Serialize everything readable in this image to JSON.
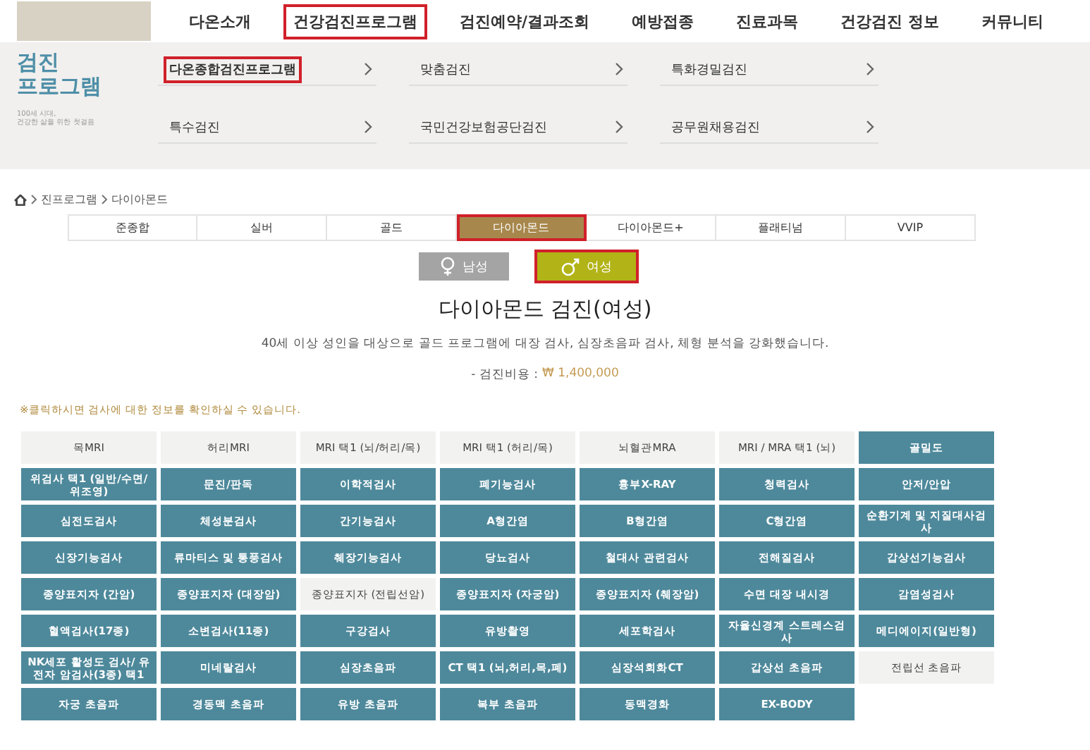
{
  "nav": [
    {
      "label": "다온소개",
      "highlighted": false
    },
    {
      "label": "건강검진프로그램",
      "highlighted": true
    },
    {
      "label": "검진예약/결과조회",
      "highlighted": false
    },
    {
      "label": "예방접종",
      "highlighted": false
    },
    {
      "label": "진료과목",
      "highlighted": false
    },
    {
      "label": "건강검진 정보",
      "highlighted": false
    },
    {
      "label": "커뮤니티",
      "highlighted": false
    }
  ],
  "submenu": {
    "title_lines": [
      "검진",
      "프로그램"
    ],
    "subtitle_lines": [
      "100세 시대,",
      "건강한 삶을 위한 첫걸음"
    ],
    "items": [
      {
        "label": "다온종합검진프로그램",
        "highlighted": true
      },
      {
        "label": "맞춤검진",
        "highlighted": false
      },
      {
        "label": "특화경밀검진",
        "highlighted": false
      },
      {
        "label": "특수검진",
        "highlighted": false
      },
      {
        "label": "국민건강보험공단검진",
        "highlighted": false
      },
      {
        "label": "공무원채용검진",
        "highlighted": false
      }
    ]
  },
  "breadcrumb": [
    "진프로그램",
    "다이아몬드"
  ],
  "tabs": [
    {
      "label": "준종합",
      "selected": false
    },
    {
      "label": "실버",
      "selected": false
    },
    {
      "label": "골드",
      "selected": false
    },
    {
      "label": "다이아몬드",
      "selected": true
    },
    {
      "label": "다이아몬드+",
      "selected": false
    },
    {
      "label": "플래티넘",
      "selected": false
    },
    {
      "label": "VVIP",
      "selected": false
    }
  ],
  "gender": [
    {
      "label": "남성",
      "selected": false
    },
    {
      "label": "여성",
      "selected": true
    }
  ],
  "title": "다이아몬드 검진(여성)",
  "description": "40세 이상 성인을 대상으로 골드 프로그램에 대장 검사, 심장초음파 검사, 체형 분석을 강화했습니다.",
  "price": {
    "label": "- 검진비용 :",
    "value": "₩ 1,400,000"
  },
  "note": "※클릭하시면 검사에 대한 정보를 확인하실 수 있습니다.",
  "tests": [
    {
      "label": "목MRI",
      "included": false
    },
    {
      "label": "허리MRI",
      "included": false
    },
    {
      "label": "MRI 택1 (뇌/허리/목)",
      "included": false
    },
    {
      "label": "MRI 택1 (허리/목)",
      "included": false
    },
    {
      "label": "뇌혈관MRA",
      "included": false
    },
    {
      "label": "MRI / MRA 택1 (뇌)",
      "included": false
    },
    {
      "label": "골밀도",
      "included": true
    },
    {
      "label": "위검사 택1 (일반/수면/위조영)",
      "included": true
    },
    {
      "label": "문진/판독",
      "included": true
    },
    {
      "label": "이학적검사",
      "included": true
    },
    {
      "label": "폐기능검사",
      "included": true
    },
    {
      "label": "흉부X-RAY",
      "included": true
    },
    {
      "label": "청력검사",
      "included": true
    },
    {
      "label": "안저/안압",
      "included": true
    },
    {
      "label": "심전도검사",
      "included": true
    },
    {
      "label": "체성분검사",
      "included": true
    },
    {
      "label": "간기능검사",
      "included": true
    },
    {
      "label": "A형간염",
      "included": true
    },
    {
      "label": "B형간염",
      "included": true
    },
    {
      "label": "C형간염",
      "included": true
    },
    {
      "label": "순환기계 및 지질대사검사",
      "included": true
    },
    {
      "label": "신장기능검사",
      "included": true
    },
    {
      "label": "류마티스 및 통풍검사",
      "included": true
    },
    {
      "label": "췌장기능검사",
      "included": true
    },
    {
      "label": "당뇨검사",
      "included": true
    },
    {
      "label": "철대사 관련검사",
      "included": true
    },
    {
      "label": "전해질검사",
      "included": true
    },
    {
      "label": "갑상선기능검사",
      "included": true
    },
    {
      "label": "종양표지자 (간암)",
      "included": true
    },
    {
      "label": "종양표지자 (대장암)",
      "included": true
    },
    {
      "label": "종양표지자 (전립선암)",
      "included": false
    },
    {
      "label": "종양표지자 (자궁암)",
      "included": true
    },
    {
      "label": "종양표지자 (췌장암)",
      "included": true
    },
    {
      "label": "수면 대장 내시경",
      "included": true
    },
    {
      "label": "감염성검사",
      "included": true
    },
    {
      "label": "혈액검사(17종)",
      "included": true
    },
    {
      "label": "소변검사(11종)",
      "included": true
    },
    {
      "label": "구강검사",
      "included": true
    },
    {
      "label": "유방촬영",
      "included": true
    },
    {
      "label": "세포학검사",
      "included": true
    },
    {
      "label": "자율신경계 스트레스검사",
      "included": true
    },
    {
      "label": "메디에이지(일반형)",
      "included": true
    },
    {
      "label": "NK세포 활성도 검사/ 유전자 암검사(3종) 택1",
      "included": true
    },
    {
      "label": "미네랄검사",
      "included": true
    },
    {
      "label": "심장초음파",
      "included": true
    },
    {
      "label": "CT 택1 (뇌,허리,목,폐)",
      "included": true
    },
    {
      "label": "심장석회화CT",
      "included": true
    },
    {
      "label": "갑상선 초음파",
      "included": true
    },
    {
      "label": "전립선 초음파",
      "included": false
    },
    {
      "label": "자궁 초음파",
      "included": true
    },
    {
      "label": "경동맥 초음파",
      "included": true
    },
    {
      "label": "유방 초음파",
      "included": true
    },
    {
      "label": "복부 초음파",
      "included": true
    },
    {
      "label": "동맥경화",
      "included": true
    },
    {
      "label": "EX-BODY",
      "included": true
    }
  ]
}
